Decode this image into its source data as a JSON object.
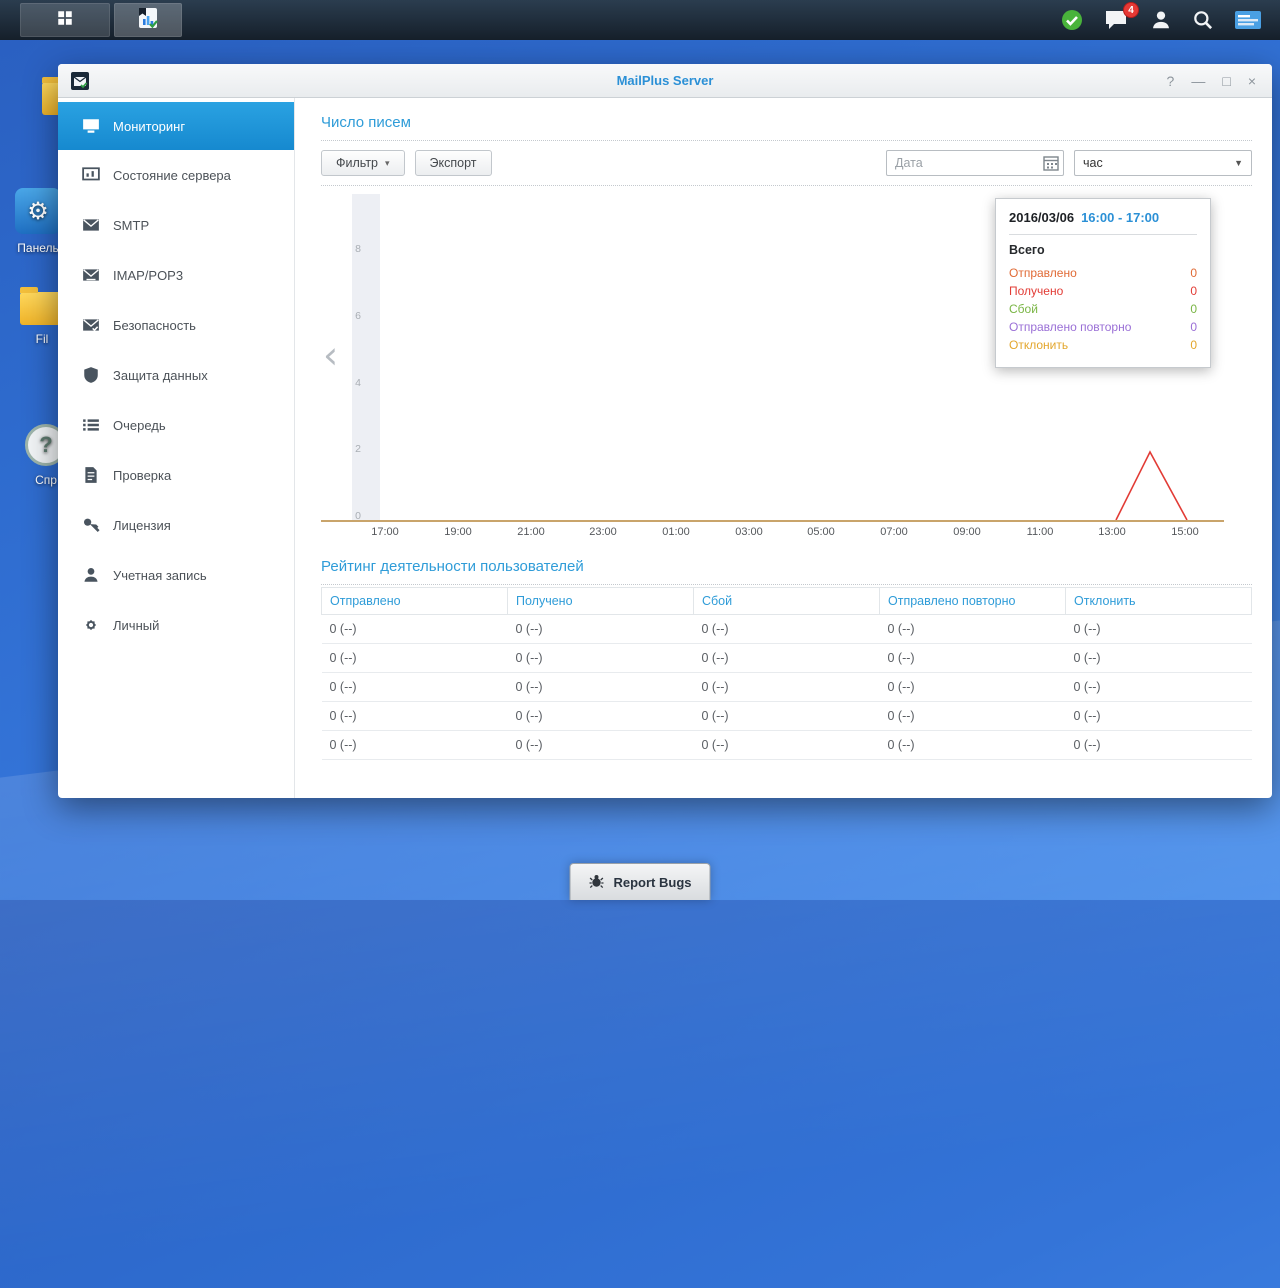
{
  "icons": {
    "caret_down": "▾",
    "select_arrow": "▼",
    "chevron_left": "‹",
    "panel_glyph": "⚙",
    "help_glyph": "?"
  },
  "taskbar": {
    "notification_count": "4"
  },
  "desktop": {
    "icon_labels": [
      "Панель",
      "Fil",
      "Спр"
    ],
    "report_bugs_label": "Report Bugs"
  },
  "window": {
    "title": "MailPlus Server",
    "titlebar": {
      "help": "?",
      "minimize": "—",
      "maximize": "□",
      "close": "×"
    },
    "sidebar": {
      "items": [
        {
          "label": "Мониторинг",
          "active": true
        },
        {
          "label": "Состояние сервера"
        },
        {
          "label": "SMTP"
        },
        {
          "label": "IMAP/POP3"
        },
        {
          "label": "Безопасность"
        },
        {
          "label": "Защита данных"
        },
        {
          "label": "Очередь"
        },
        {
          "label": "Проверка"
        },
        {
          "label": "Лицензия"
        },
        {
          "label": "Учетная запись"
        },
        {
          "label": "Личный"
        }
      ]
    },
    "toolbar": {
      "filter_label": "Фильтр",
      "export_label": "Экспорт",
      "date_placeholder": "Дата",
      "interval_value": "час"
    },
    "sections": {
      "mail_count_title": "Число писем",
      "user_activity_title": "Рейтинг деятельности пользователей"
    }
  },
  "chart_data": {
    "type": "line",
    "title": "Число писем",
    "x_ticks": [
      "17:00",
      "19:00",
      "21:00",
      "23:00",
      "01:00",
      "03:00",
      "05:00",
      "07:00",
      "09:00",
      "11:00",
      "13:00",
      "15:00"
    ],
    "y_ticks": [
      "8",
      "6",
      "4",
      "2",
      "0"
    ],
    "ylim": [
      0,
      9
    ],
    "grid": false,
    "legend": false,
    "series": [
      {
        "name": "Получено",
        "color": "#e23c36",
        "points": [
          {
            "x": "13:30",
            "y": 0
          },
          {
            "x": "14:00",
            "y": 2
          },
          {
            "x": "14:30",
            "y": 0
          }
        ]
      }
    ]
  },
  "tooltip": {
    "date": "2016/03/06",
    "time_range": "16:00 - 17:00",
    "total_label": "Всего",
    "rows": [
      {
        "label": "Отправлено",
        "value": "0",
        "color": "#e06a35"
      },
      {
        "label": "Получено",
        "value": "0",
        "color": "#e23c36"
      },
      {
        "label": "Сбой",
        "value": "0",
        "color": "#79b544"
      },
      {
        "label": "Отправлено повторно",
        "value": "0",
        "color": "#9a6fd6"
      },
      {
        "label": "Отклонить",
        "value": "0",
        "color": "#e3a62c"
      }
    ]
  },
  "table": {
    "headers": [
      "Отправлено",
      "Получено",
      "Сбой",
      "Отправлено повторно",
      "Отклонить"
    ],
    "rows": [
      [
        "0 (--)",
        "0 (--)",
        "0 (--)",
        "0 (--)",
        "0 (--)"
      ],
      [
        "0 (--)",
        "0 (--)",
        "0 (--)",
        "0 (--)",
        "0 (--)"
      ],
      [
        "0 (--)",
        "0 (--)",
        "0 (--)",
        "0 (--)",
        "0 (--)"
      ],
      [
        "0 (--)",
        "0 (--)",
        "0 (--)",
        "0 (--)",
        "0 (--)"
      ],
      [
        "0 (--)",
        "0 (--)",
        "0 (--)",
        "0 (--)",
        "0 (--)"
      ]
    ]
  }
}
